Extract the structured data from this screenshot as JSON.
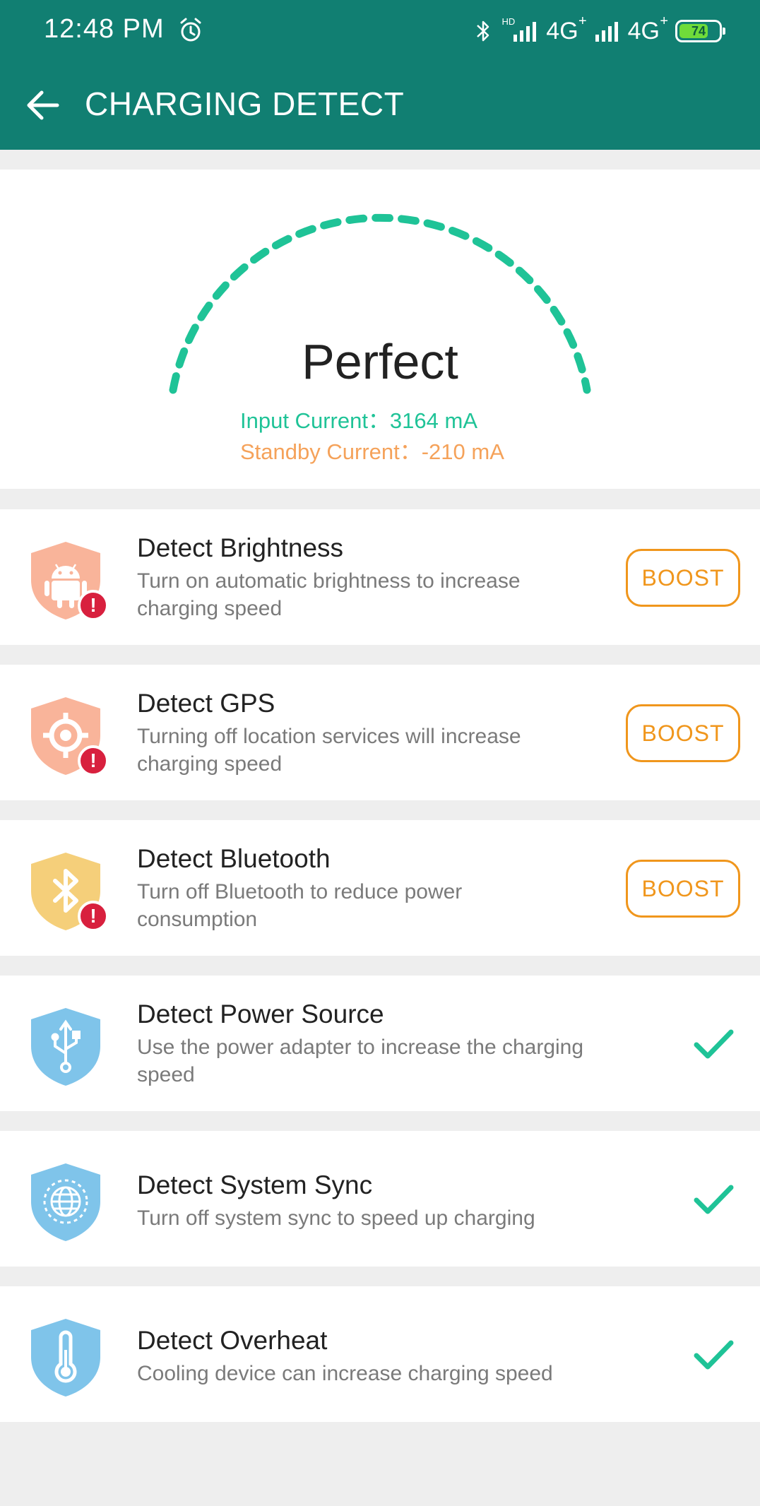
{
  "status_bar": {
    "time": "12:48 PM",
    "network1": "4G",
    "network2": "4G",
    "network_plus": "+",
    "hd": "HD",
    "battery": "74",
    "battery_level": 0.74
  },
  "header": {
    "title": "CHARGING DETECT"
  },
  "hero": {
    "status": "Perfect",
    "input_current": "Input Current：3164 mA",
    "standby_current": "Standby Current：-210 mA",
    "accent_color": "#1fc397"
  },
  "items": [
    {
      "title": "Detect Brightness",
      "desc_line1": "Turn on automatic brightness to increase",
      "desc_line2": "charging speed",
      "icon": "android-icon",
      "shield_color": "#f9b49a",
      "action": "BOOST"
    },
    {
      "title": "Detect GPS",
      "desc_line1": "Turning off location services will increase",
      "desc_line2": "charging speed",
      "icon": "gps-icon",
      "shield_color": "#f9b49a",
      "action": "BOOST"
    },
    {
      "title": "Detect Bluetooth",
      "desc_line1": "Turn off Bluetooth to reduce power",
      "desc_line2": "consumption",
      "icon": "bluetooth-icon",
      "shield_color": "#f5cf7a",
      "action": "BOOST"
    },
    {
      "title": "Detect Power Source",
      "desc_line1": "Use the power adapter to increase the charging",
      "desc_line2": "speed",
      "icon": "usb-icon",
      "shield_color": "#7fc4ea",
      "action": "check"
    },
    {
      "title": "Detect System Sync",
      "desc_line1": "Turn off system sync to speed up charging",
      "icon": "globe-icon",
      "shield_color": "#7fc4ea",
      "action": "check"
    },
    {
      "title": "Detect Overheat",
      "desc_line1": "Cooling device can increase charging speed",
      "icon": "thermometer-icon",
      "shield_color": "#7fc4ea",
      "action": "check"
    }
  ],
  "colors": {
    "header": "#117f72",
    "boost": "#f0961c",
    "check": "#1fc397",
    "alert": "#d8203e"
  }
}
